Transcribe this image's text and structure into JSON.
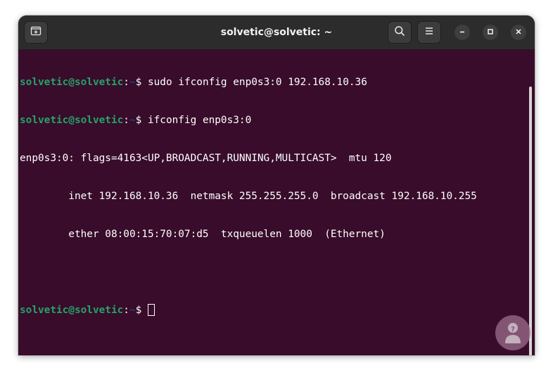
{
  "window": {
    "title": "solvetic@solvetic: ~"
  },
  "titlebar": {
    "icons": [
      "new-tab-icon",
      "search-icon",
      "hamburger-menu-icon",
      "minimize-icon",
      "maximize-icon",
      "close-icon"
    ]
  },
  "terminal": {
    "lines": [
      {
        "user": "solvetic@solvetic",
        "colon": ":",
        "path": "~",
        "prompt": "$ ",
        "command": "sudo ifconfig enp0s3:0 192.168.10.36"
      },
      {
        "user": "solvetic@solvetic",
        "colon": ":",
        "path": "~",
        "prompt": "$ ",
        "command": "ifconfig enp0s3:0"
      },
      {
        "text": "enp0s3:0: flags=4163<UP,BROADCAST,RUNNING,MULTICAST>  mtu 120"
      },
      {
        "text": "        inet 192.168.10.36  netmask 255.255.255.0  broadcast 192.168.10.255"
      },
      {
        "text": "        ether 08:00:15:70:07:d5  txqueuelen 1000  (Ethernet)"
      },
      {
        "text": ""
      },
      {
        "user": "solvetic@solvetic",
        "colon": ":",
        "path": "~",
        "prompt": "$ ",
        "command": ""
      }
    ]
  },
  "colors": {
    "terminal_bg": "#380c2a",
    "titlebar_bg": "#2c2c2c",
    "prompt_user": "#26a269",
    "prompt_path": "#12488b",
    "text": "#ffffff"
  },
  "watermark": {
    "icon": "solvetic-logo-icon"
  }
}
